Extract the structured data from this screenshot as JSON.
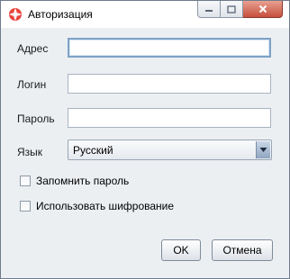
{
  "window": {
    "title": "Авторизация",
    "controls": {
      "minimize": "minimize-icon",
      "maximize": "maximize-icon",
      "close": "close-icon"
    }
  },
  "form": {
    "address": {
      "label": "Адрес",
      "value": ""
    },
    "login": {
      "label": "Логин",
      "value": ""
    },
    "password": {
      "label": "Пароль",
      "value": ""
    },
    "language": {
      "label": "Язык",
      "selected": "Русский"
    },
    "remember_password": {
      "label": "Запомнить пароль",
      "checked": false
    },
    "use_encryption": {
      "label": "Использовать шифрование",
      "checked": false
    }
  },
  "buttons": {
    "ok": "OK",
    "cancel": "Отмена"
  },
  "colors": {
    "close_button": "#c7503d",
    "focus_border": "#7ea3c6",
    "background": "#eceff2"
  }
}
